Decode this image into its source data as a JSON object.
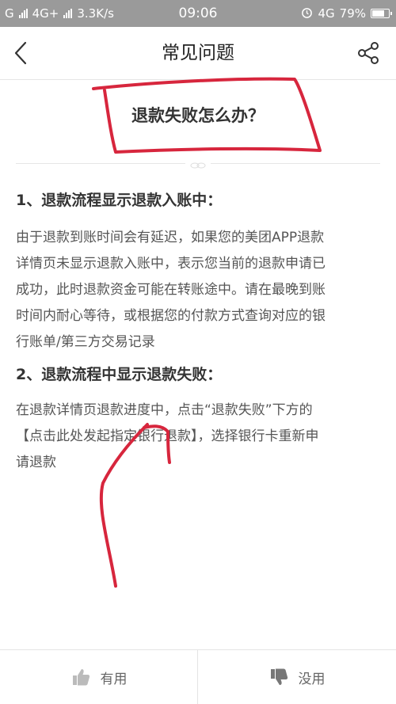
{
  "status_bar": {
    "carrier_left": "G",
    "network_left": "4G+",
    "speed": "3.3K/s",
    "time": "09:06",
    "network_right": "4G",
    "battery": "79%",
    "battery_level": 0.79
  },
  "nav": {
    "title": "常见问题"
  },
  "article": {
    "question": "退款失败怎么办？",
    "section1_heading": "1、退款流程显示退款入账中：",
    "section1_lines": [
      "由于退款到账时间会有延迟，如果您的美团APP退款",
      "详情页未显示退款入账中，表示您当前的退款申请已",
      "成功，此时退款资金可能在转账途中。请在最晚到账",
      "时间内耐心等待，或根据您的付款方式查询对应的银",
      "行账单/第三方交易记录"
    ],
    "section2_heading": "2、退款流程中显示退款失败：",
    "section2_lines": [
      "在退款详情页退款进度中，点击“退款失败”下方的",
      "【点击此处发起指定银行退款】，选择银行卡重新申",
      "请退款"
    ]
  },
  "footer": {
    "useful_label": "有用",
    "useless_label": "没用"
  },
  "colors": {
    "status_bar_bg": "#9a9a9a",
    "annotation_red": "#d7263d"
  }
}
